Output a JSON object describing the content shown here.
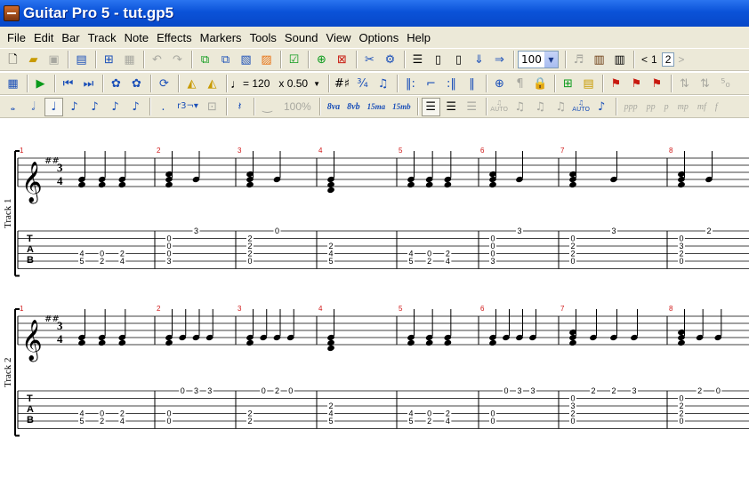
{
  "window": {
    "title": "Guitar Pro 5 - tut.gp5"
  },
  "menu": [
    "File",
    "Edit",
    "Bar",
    "Track",
    "Note",
    "Effects",
    "Markers",
    "Tools",
    "Sound",
    "View",
    "Options",
    "Help"
  ],
  "toolbar1": {
    "icons": [
      "new-file-icon",
      "open-folder-icon",
      "save-icon",
      "print-preview-icon",
      "page-setup-icon",
      "print-icon",
      "undo-icon",
      "redo-icon",
      "copy-icon",
      "paste-icon",
      "copy-special-icon",
      "paste-special-icon",
      "check-bar-icon",
      "insert-bar-icon",
      "delete-bar-icon",
      "cut-icon",
      "settings-icon",
      "multitrack-view-icon",
      "page-view-icon",
      "screen-view-icon",
      "parchment-view-icon",
      "wrap-view-icon",
      "guitar-icon",
      "fretboard-icon",
      "keyboard-icon"
    ],
    "zoom": "100",
    "page_prev": "<",
    "page_current": "1",
    "page_of": "2",
    "page_next": ">"
  },
  "toolbar2": {
    "tempo": "= 120",
    "speed": "x 0.50",
    "icons": [
      "mixer-icon",
      "play-icon",
      "go-start-icon",
      "go-end-icon",
      "paw-icon",
      "paw-double-icon",
      "loop-icon",
      "metronome-icon",
      "count-in-icon",
      "tempo-note-icon",
      "sharp-flat-icon",
      "time-signature-icon",
      "tuplet-icon",
      "repeat-open-icon",
      "repeat-alt-icon",
      "repeat-close-icon",
      "double-bar-icon",
      "direction-icon",
      "pilcrow-icon",
      "lock-icon",
      "add-track-icon",
      "track-props-icon",
      "marker-icon",
      "marker-next-icon",
      "marker-prev-icon",
      "rehearsal-icon",
      "lyrics-icon",
      "diagram-icon"
    ]
  },
  "toolbar3": {
    "volume": "100%",
    "ottava_up": "8va",
    "ottava_down": "8vb",
    "quindicesima_up": "15ma",
    "quindicesima_down": "15mb",
    "auto_label_1": "AUTO",
    "auto_label_2": "AUTO",
    "dynamics": [
      "ppp",
      "pp",
      "p",
      "mp",
      "mf",
      "f"
    ],
    "icons": [
      "whole-note-icon",
      "half-note-icon",
      "quarter-note-icon",
      "eighth-note-icon",
      "sixteenth-note-icon",
      "thirty-second-note-icon",
      "sixty-fourth-note-icon",
      "dotted-icon",
      "triplet-icon",
      "rest-icon",
      "tie-icon"
    ]
  },
  "score": {
    "tracks": [
      {
        "label": "Track 1"
      },
      {
        "label": "Track 2"
      }
    ],
    "bar_numbers": [
      "1",
      "2",
      "3",
      "4",
      "5",
      "6",
      "7",
      "8"
    ],
    "time_signature": {
      "top": "3",
      "bottom": "4"
    },
    "key_signature": "##",
    "tab_letters": [
      "T",
      "A",
      "B"
    ],
    "track1_tab": [
      [
        "4 5",
        "0 2",
        "2 4"
      ],
      [
        "0 0 0 3",
        "3"
      ],
      [
        "2 2 2 0",
        "0"
      ],
      [
        "2 4 5"
      ],
      [
        "4 5",
        "0 2",
        "2 4"
      ],
      [
        "0 0 0 3",
        "3"
      ],
      [
        "0 2 2 0",
        "3"
      ],
      [
        "0 3 2 0",
        "2"
      ]
    ],
    "track2_tab": [
      [
        "4 5",
        "0 2",
        "2 4"
      ],
      [
        "0 0",
        "0",
        "3",
        "3"
      ],
      [
        "2 2",
        "0",
        "2",
        "0"
      ],
      [
        "2 4 5"
      ],
      [
        "4 5",
        "0 2",
        "2 4"
      ],
      [
        "0 0",
        "0",
        "3",
        "3"
      ],
      [
        "0 3 2 0",
        "2",
        "2",
        "3"
      ],
      [
        "0 2 2 0",
        "2",
        "0"
      ]
    ]
  }
}
